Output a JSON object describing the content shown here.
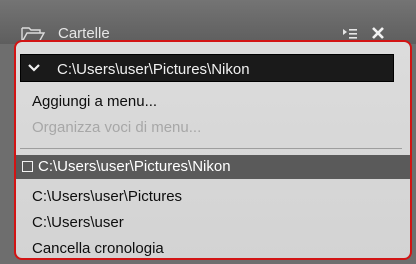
{
  "panel": {
    "title": "Cartelle",
    "icons": [
      "folder-icon",
      "list-view-icon",
      "close-icon"
    ]
  },
  "dropdown": {
    "current_path": "C:\\Users\\user\\Pictures\\Nikon",
    "menu_items": [
      {
        "label": "Aggiungi a menu...",
        "enabled": true
      },
      {
        "label": "Organizza voci di menu...",
        "enabled": false
      }
    ],
    "history": [
      {
        "label": "C:\\Users\\user\\Pictures\\Nikon",
        "selected": true
      },
      {
        "label": "C:\\Users\\user\\Pictures",
        "selected": false
      },
      {
        "label": "C:\\Users\\user",
        "selected": false
      }
    ],
    "clear_history": "Cancella cronologia"
  },
  "colors": {
    "highlight_border": "#d21414",
    "selected_row": "#5a5a5a",
    "menu_background": "#d8d8d8"
  }
}
